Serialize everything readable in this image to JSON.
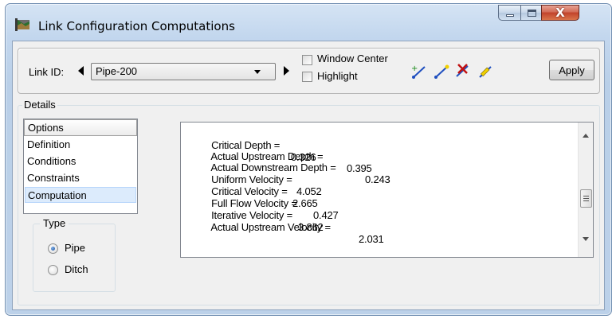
{
  "window": {
    "title": "Link Configuration Computations",
    "colors": {
      "accent": "#c2432c",
      "frame": "#c3d7ee",
      "selection": "#dcebfc"
    },
    "controls": {
      "minimize_icon": "minimize-icon",
      "maximize_icon": "maximize-icon",
      "close_icon": "close-icon",
      "close_glyph": "X"
    }
  },
  "toolbar": {
    "link_id_label": "Link ID:",
    "link_id_value": "Pipe-200",
    "window_center_label": "Window Center",
    "highlight_label": "Highlight",
    "tool_icons": [
      "add-link-icon",
      "select-link-icon",
      "delete-link-icon",
      "edit-link-icon"
    ],
    "apply_label": "Apply"
  },
  "details": {
    "label": "Details",
    "options_header": "Options",
    "options": [
      "Definition",
      "Conditions",
      "Constraints",
      "Computation"
    ],
    "selected_option": "Computation",
    "type_label": "Type",
    "type_options": [
      "Pipe",
      "Ditch"
    ],
    "selected_type": "Pipe"
  },
  "results": [
    {
      "label": "Critical Depth =",
      "value": "0.326"
    },
    {
      "label": "Actual Upstream Depth =",
      "value": "0.395"
    },
    {
      "label": "Actual Downstream Depth =",
      "value": "0.243"
    },
    {
      "label": "Uniform Velocity =",
      "value": "4.052"
    },
    {
      "label": "Critical Velocity =",
      "value": "2.665"
    },
    {
      "label": "Full Flow Velocity =",
      "value": "0.427"
    },
    {
      "label": "Iterative Velocity =",
      "value": "3.862"
    },
    {
      "label": "Actual Upstream Velocity =",
      "value": "2.031"
    }
  ]
}
